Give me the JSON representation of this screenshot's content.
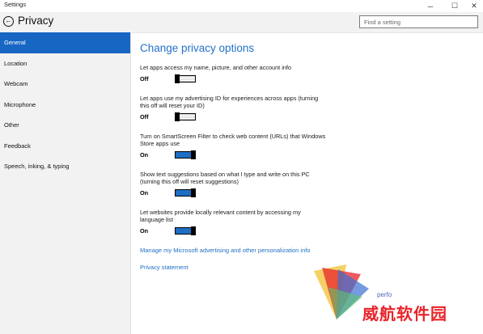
{
  "window": {
    "title": "Settings"
  },
  "header": {
    "title": "Privacy",
    "search_placeholder": "Find a setting"
  },
  "sidebar": {
    "items": [
      {
        "label": "General",
        "active": true
      },
      {
        "label": "Location"
      },
      {
        "label": "Webcam"
      },
      {
        "label": "Microphone"
      },
      {
        "label": "Other"
      },
      {
        "label": "Feedback"
      },
      {
        "label": "Speech, inking, & typing"
      }
    ]
  },
  "main": {
    "heading": "Change privacy options",
    "settings": [
      {
        "description": "Let apps access my name, picture, and other account info",
        "state": "Off"
      },
      {
        "description": "Let apps use my advertising ID for experiences across apps (turning this off will reset your ID)",
        "state": "Off"
      },
      {
        "description": "Turn on SmartScreen Filter to check web content (URLs) that Windows Store apps use",
        "state": "On"
      },
      {
        "description": "Show text suggestions based on what I type and write on this PC (turning this off will reset suggestions)",
        "state": "On"
      },
      {
        "description": "Let websites provide locally relevant content by accessing my language list",
        "state": "On"
      }
    ],
    "links": [
      "Manage my Microsoft advertising and other personalization info",
      "Privacy statement"
    ]
  },
  "watermark": {
    "text": "威航软件园",
    "small_text": "perfo"
  },
  "colors": {
    "accent": "#1766c4",
    "link": "#2170c4",
    "toggle_on": "#1e6ec4",
    "watermark_red": "#e8242a"
  },
  "icons": {
    "back": "back-arrow-icon",
    "minimize": "minimize-icon",
    "maximize": "maximize-icon",
    "close": "close-icon"
  }
}
